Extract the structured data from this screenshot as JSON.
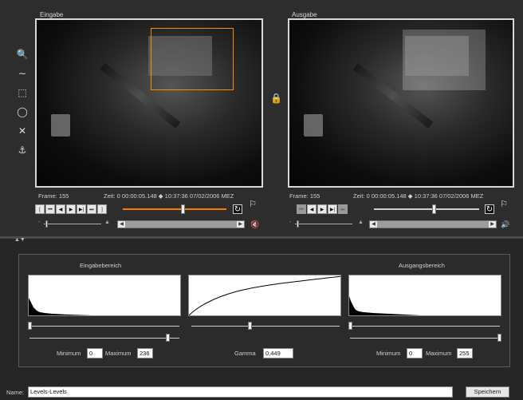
{
  "input_pane": {
    "title": "Eingabe",
    "frame": "Frame: 155",
    "zeit": "Zeit: 0 00:00:05.148 ◆ 10:37:36 07/02/2006 MEZ"
  },
  "output_pane": {
    "title": "Ausgabe",
    "frame": "Frame: 155",
    "zeit": "Zeit: 0 00:00:05.148 ◆ 10:37:36 07/02/2006 MEZ"
  },
  "tools": [
    {
      "name": "zoom-icon",
      "glyph": "🔍"
    },
    {
      "name": "wave-icon",
      "glyph": "∼"
    },
    {
      "name": "rect-select-icon",
      "glyph": "⬚"
    },
    {
      "name": "circle-select-icon",
      "glyph": "◯"
    },
    {
      "name": "close-icon",
      "glyph": "✕"
    },
    {
      "name": "anchor-icon",
      "glyph": "⚓"
    }
  ],
  "transport": {
    "in": "[",
    "start": "⏮",
    "prev": "◀",
    "play": "▶",
    "next": "▶|",
    "end": "⏭",
    "out": "]"
  },
  "levels": {
    "input_title": "Eingabebereich",
    "output_title": "Ausgangsbereich",
    "input_min_label": "Minimum",
    "input_min": "0",
    "input_max_label": "Maximum",
    "input_max": "236",
    "gamma_label": "Gamma",
    "gamma": "0,449",
    "output_min_label": "Minimum",
    "output_min": "0",
    "output_max_label": "Maximum",
    "output_max": "255"
  },
  "footer": {
    "name_label": "Name:",
    "name_value": "Levels-Levels",
    "save_label": "Speichern"
  },
  "colors": {
    "accent": "#ff8a00",
    "muted_speaker": "#ff3030"
  }
}
